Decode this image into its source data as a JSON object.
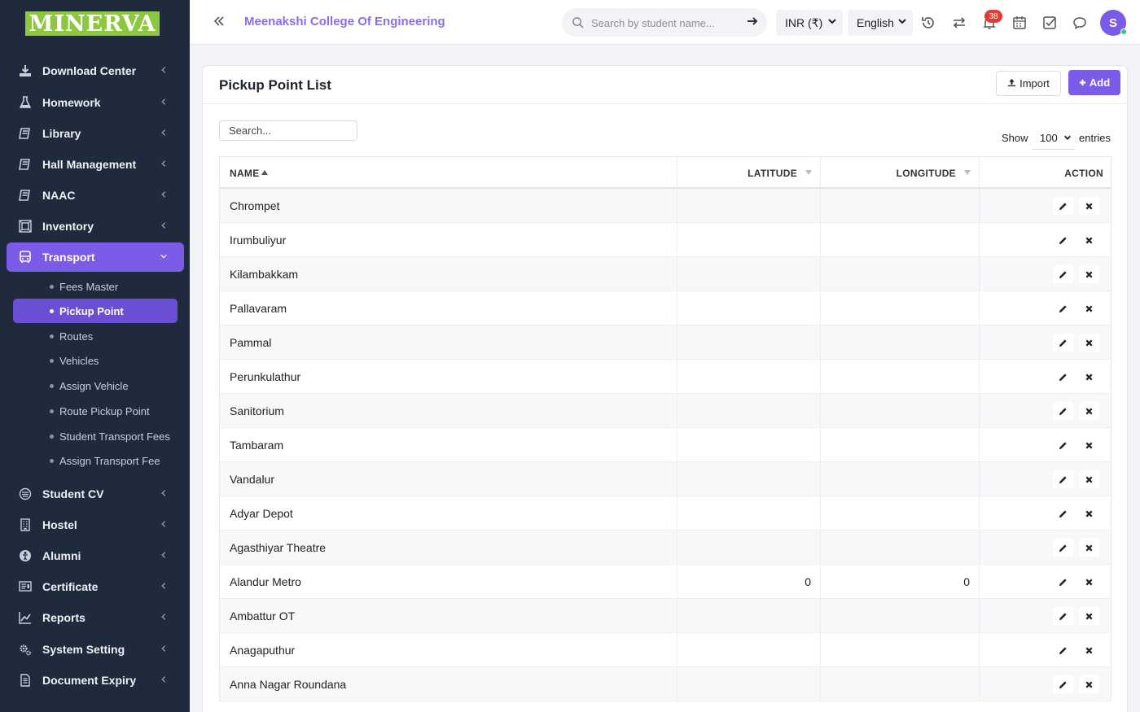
{
  "logo_text": "MINERVA",
  "sidebar": {
    "items": [
      {
        "label": "Download Center",
        "icon": "download-icon"
      },
      {
        "label": "Homework",
        "icon": "flask-icon"
      },
      {
        "label": "Library",
        "icon": "book-icon"
      },
      {
        "label": "Hall Management",
        "icon": "book-icon"
      },
      {
        "label": "NAAC",
        "icon": "book-icon"
      },
      {
        "label": "Inventory",
        "icon": "inventory-icon"
      },
      {
        "label": "Transport",
        "icon": "bus-icon",
        "active": true
      },
      {
        "label": "Student CV",
        "icon": "cv-icon"
      },
      {
        "label": "Hostel",
        "icon": "building-icon"
      },
      {
        "label": "Alumni",
        "icon": "alumni-icon"
      },
      {
        "label": "Certificate",
        "icon": "certificate-icon"
      },
      {
        "label": "Reports",
        "icon": "chart-line-icon"
      },
      {
        "label": "System Setting",
        "icon": "gears-icon"
      },
      {
        "label": "Document Expiry",
        "icon": "document-icon"
      }
    ],
    "transport_sub": [
      {
        "label": "Fees Master"
      },
      {
        "label": "Pickup Point",
        "active": true
      },
      {
        "label": "Routes"
      },
      {
        "label": "Vehicles"
      },
      {
        "label": "Assign Vehicle"
      },
      {
        "label": "Route Pickup Point"
      },
      {
        "label": "Student Transport Fees"
      },
      {
        "label": "Assign Transport Fee"
      }
    ]
  },
  "header": {
    "college_name": "Meenakshi College Of Engineering",
    "search_placeholder": "Search by student name...",
    "currency": "INR (₹)",
    "language": "English",
    "notification_count": "38",
    "avatar_initial": "S"
  },
  "page": {
    "title": "Pickup Point List",
    "import_label": "Import",
    "add_label": "Add",
    "search_placeholder": "Search...",
    "show_label": "Show",
    "entries_value": "100",
    "entries_label": "entries"
  },
  "table": {
    "columns": [
      "NAME",
      "LATITUDE",
      "LONGITUDE",
      "ACTION"
    ],
    "rows": [
      {
        "name": "Chrompet",
        "lat": "",
        "lng": ""
      },
      {
        "name": "Irumbuliyur",
        "lat": "",
        "lng": ""
      },
      {
        "name": "Kilambakkam",
        "lat": "",
        "lng": ""
      },
      {
        "name": "Pallavaram",
        "lat": "",
        "lng": ""
      },
      {
        "name": "Pammal",
        "lat": "",
        "lng": ""
      },
      {
        "name": "Perunkulathur",
        "lat": "",
        "lng": ""
      },
      {
        "name": "Sanitorium",
        "lat": "",
        "lng": ""
      },
      {
        "name": "Tambaram",
        "lat": "",
        "lng": ""
      },
      {
        "name": "Vandalur",
        "lat": "",
        "lng": ""
      },
      {
        "name": "Adyar Depot",
        "lat": "",
        "lng": ""
      },
      {
        "name": "Agasthiyar Theatre",
        "lat": "",
        "lng": ""
      },
      {
        "name": "Alandur Metro",
        "lat": "0",
        "lng": "0"
      },
      {
        "name": "Ambattur OT",
        "lat": "",
        "lng": ""
      },
      {
        "name": "Anagaputhur",
        "lat": "",
        "lng": ""
      },
      {
        "name": "Anna Nagar Roundana",
        "lat": "",
        "lng": ""
      }
    ]
  },
  "colors": {
    "accent": "#7b5ce8",
    "sidebar_bg": "#1f2b3d",
    "logo_bg": "#8dc63f",
    "badge": "#e53935"
  }
}
